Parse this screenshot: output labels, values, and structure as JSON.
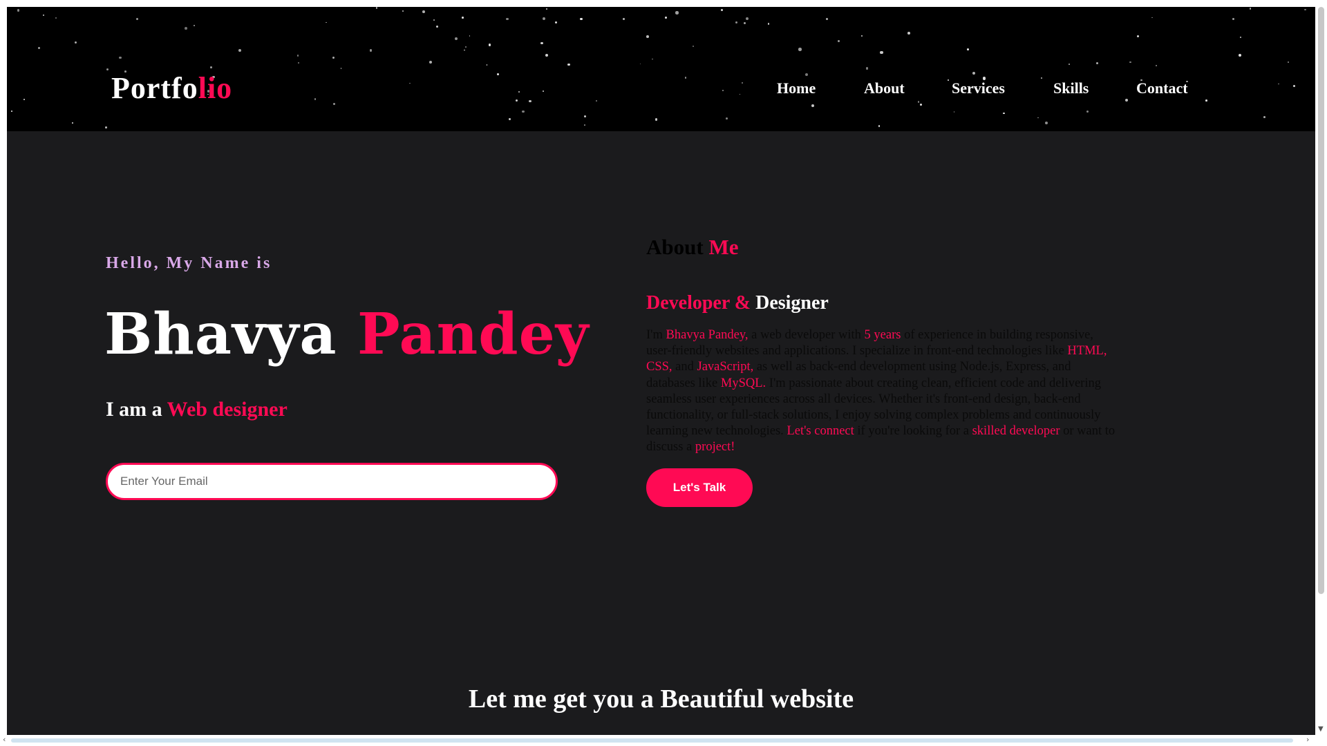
{
  "header": {
    "logo_main": "Portfo",
    "logo_accent": "lio",
    "nav": [
      {
        "label": "Home"
      },
      {
        "label": "About"
      },
      {
        "label": "Services"
      },
      {
        "label": "Skills"
      },
      {
        "label": "Contact"
      }
    ]
  },
  "hero": {
    "greeting": "Hello, My Name is",
    "first_name": "Bhavya",
    "last_name": "Pandey",
    "role_prefix": "I am a",
    "role": "Web designer",
    "email_placeholder": "Enter Your Email"
  },
  "about": {
    "title_main": "About",
    "title_accent": "Me",
    "subtitle_accent": "Developer &",
    "subtitle_main": "Designer",
    "paragraph": [
      {
        "text": "I'm ",
        "highlight": false
      },
      {
        "text": "Bhavya Pandey,",
        "highlight": true
      },
      {
        "text": " a web developer with ",
        "highlight": false
      },
      {
        "text": "5 years",
        "highlight": true
      },
      {
        "text": " of experience in building responsive, user-friendly websites and applications. I specialize in front-end technologies like ",
        "highlight": false
      },
      {
        "text": "HTML, CSS,",
        "highlight": true
      },
      {
        "text": " and ",
        "highlight": false
      },
      {
        "text": "JavaScript,",
        "highlight": true
      },
      {
        "text": " as well as back-end development using Node.js, Express, and databases like ",
        "highlight": false
      },
      {
        "text": "MySQL.",
        "highlight": true
      },
      {
        "text": " I'm passionate about creating clean, efficient code and delivering seamless user experiences across all devices. Whether it's front-end design, back-end functionality, or full-stack solutions, I enjoy solving complex problems and continuously learning new technologies. ",
        "highlight": false
      },
      {
        "text": "Let's connect",
        "highlight": true
      },
      {
        "text": " if you're looking for a ",
        "highlight": false
      },
      {
        "text": "skilled developer",
        "highlight": true
      },
      {
        "text": " or want to discuss a ",
        "highlight": false
      },
      {
        "text": "project!",
        "highlight": true
      }
    ],
    "button_label": "Let's Talk"
  },
  "tagline": "Let me get you a Beautiful website",
  "colors": {
    "accent": "#ff0a54",
    "background": "#1b1b1d",
    "header_background": "#000000",
    "greeting": "#d9a8e8"
  }
}
